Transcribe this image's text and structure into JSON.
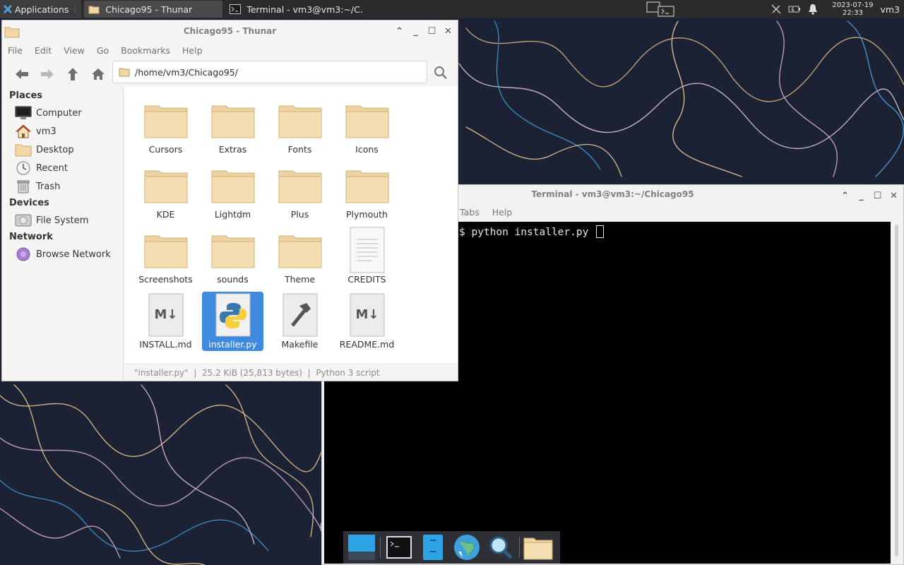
{
  "top_panel": {
    "applications_label": "Applications",
    "tasks": [
      {
        "label": "Chicago95 - Thunar",
        "icon": "folder-icon"
      },
      {
        "label": "Terminal - vm3@vm3:~/C...",
        "icon": "terminal-icon"
      }
    ],
    "clock": {
      "date": "2023-07-19",
      "time": "22:33"
    },
    "user": "vm3"
  },
  "thunar": {
    "title": "Chicago95 - Thunar",
    "menu": [
      "File",
      "Edit",
      "View",
      "Go",
      "Bookmarks",
      "Help"
    ],
    "location": "/home/vm3/Chicago95/",
    "sidebar": {
      "places_heading": "Places",
      "places": [
        "Computer",
        "vm3",
        "Desktop",
        "Recent",
        "Trash"
      ],
      "devices_heading": "Devices",
      "devices": [
        "File System"
      ],
      "network_heading": "Network",
      "network": [
        "Browse Network"
      ]
    },
    "files": [
      {
        "name": "Cursors",
        "type": "folder"
      },
      {
        "name": "Extras",
        "type": "folder"
      },
      {
        "name": "Fonts",
        "type": "folder"
      },
      {
        "name": "Icons",
        "type": "folder"
      },
      {
        "name": "KDE",
        "type": "folder"
      },
      {
        "name": "Lightdm",
        "type": "folder"
      },
      {
        "name": "Plus",
        "type": "folder"
      },
      {
        "name": "Plymouth",
        "type": "folder"
      },
      {
        "name": "Screenshots",
        "type": "folder"
      },
      {
        "name": "sounds",
        "type": "folder"
      },
      {
        "name": "Theme",
        "type": "folder"
      },
      {
        "name": "CREDITS",
        "type": "text"
      },
      {
        "name": "INSTALL.md",
        "type": "markdown"
      },
      {
        "name": "installer.py",
        "type": "python",
        "selected": true
      },
      {
        "name": "Makefile",
        "type": "makefile"
      },
      {
        "name": "README.md",
        "type": "markdown"
      }
    ],
    "status": "\"installer.py\"  |  25.2 KiB (25,813 bytes)  |  Python 3 script"
  },
  "terminal": {
    "title": "Terminal - vm3@vm3:~/Chicago95",
    "menu_visible": [
      "Tabs",
      "Help"
    ],
    "prompt_line": "$ python installer.py "
  },
  "dock": {
    "items": [
      "show-desktop",
      "terminal",
      "file-manager",
      "web-browser",
      "app-finder",
      "home-folder"
    ]
  },
  "colors": {
    "panel": "#2b2b2b",
    "selection": "#3d8ae0",
    "folder": "#f0d7a5",
    "wallpaper": "#1a2132"
  }
}
